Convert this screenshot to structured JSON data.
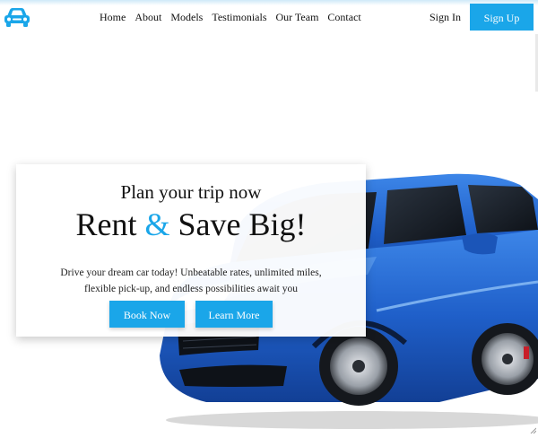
{
  "colors": {
    "accent": "#1aa6e9",
    "text": "#111111",
    "background": "#ffffff",
    "car_body": "#1f5fc9"
  },
  "header": {
    "logo_icon": "car-icon",
    "nav": [
      {
        "label": "Home"
      },
      {
        "label": "About"
      },
      {
        "label": "Models"
      },
      {
        "label": "Testimonials"
      },
      {
        "label": "Our Team"
      },
      {
        "label": "Contact"
      }
    ],
    "sign_in": "Sign In",
    "sign_up": "Sign Up"
  },
  "hero": {
    "kicker": "Plan your trip now",
    "headline_part1": "Rent",
    "headline_amp": "&",
    "headline_part2": "Save Big!",
    "description": "Drive your dream car today! Unbeatable rates, unlimited miles, flexible pick-up, and endless possibilities await you",
    "book_button": "Book Now",
    "learn_button": "Learn More",
    "image_icon": "blue-suv-image"
  }
}
